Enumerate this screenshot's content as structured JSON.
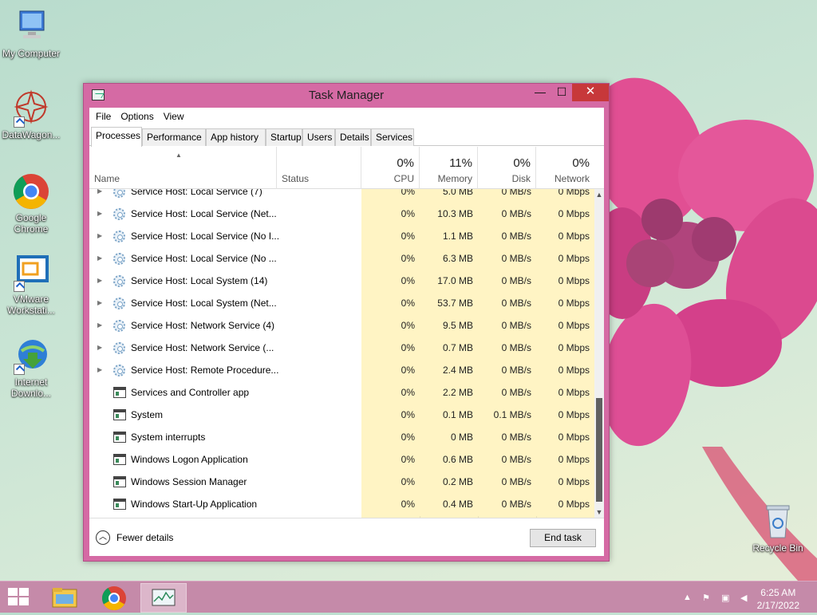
{
  "desktop": {
    "icons": [
      {
        "label": "My Computer",
        "icon": "computer-icon"
      },
      {
        "label": "DataWagon...",
        "icon": "datawagon-icon"
      },
      {
        "label": "Google Chrome",
        "icon": "chrome-icon"
      },
      {
        "label": "VMware Workstati...",
        "icon": "vmware-icon"
      },
      {
        "label": "Internet Downlo...",
        "icon": "idm-icon"
      },
      {
        "label": "Recycle Bin",
        "icon": "recycle-bin-icon"
      }
    ]
  },
  "window": {
    "title": "Task Manager",
    "controls": {
      "minimize": "—",
      "maximize": "☐",
      "close": "✕"
    },
    "menu": [
      "File",
      "Options",
      "View"
    ],
    "tabs": [
      "Processes",
      "Performance",
      "App history",
      "Startup",
      "Users",
      "Details",
      "Services"
    ],
    "active_tab": "Processes",
    "columns": {
      "name": "Name",
      "status": "Status",
      "cpu": {
        "pct": "0%",
        "label": "CPU"
      },
      "memory": {
        "pct": "11%",
        "label": "Memory"
      },
      "disk": {
        "pct": "0%",
        "label": "Disk"
      },
      "network": {
        "pct": "0%",
        "label": "Network"
      }
    },
    "processes": [
      {
        "name": "Service Host: Local Service (7)",
        "cpu": "0%",
        "memory": "5.0 MB",
        "disk": "0 MB/s",
        "network": "0 Mbps",
        "expandable": true,
        "icon": "gear"
      },
      {
        "name": "Service Host: Local Service (Net...",
        "cpu": "0%",
        "memory": "10.3 MB",
        "disk": "0 MB/s",
        "network": "0 Mbps",
        "expandable": true,
        "icon": "gear"
      },
      {
        "name": "Service Host: Local Service (No I...",
        "cpu": "0%",
        "memory": "1.1 MB",
        "disk": "0 MB/s",
        "network": "0 Mbps",
        "expandable": true,
        "icon": "gear"
      },
      {
        "name": "Service Host: Local Service (No ...",
        "cpu": "0%",
        "memory": "6.3 MB",
        "disk": "0 MB/s",
        "network": "0 Mbps",
        "expandable": true,
        "icon": "gear"
      },
      {
        "name": "Service Host: Local System (14)",
        "cpu": "0%",
        "memory": "17.0 MB",
        "disk": "0 MB/s",
        "network": "0 Mbps",
        "expandable": true,
        "icon": "gear"
      },
      {
        "name": "Service Host: Local System (Net...",
        "cpu": "0%",
        "memory": "53.7 MB",
        "disk": "0 MB/s",
        "network": "0 Mbps",
        "expandable": true,
        "icon": "gear"
      },
      {
        "name": "Service Host: Network Service (4)",
        "cpu": "0%",
        "memory": "9.5 MB",
        "disk": "0 MB/s",
        "network": "0 Mbps",
        "expandable": true,
        "icon": "gear"
      },
      {
        "name": "Service Host: Network Service (...",
        "cpu": "0%",
        "memory": "0.7 MB",
        "disk": "0 MB/s",
        "network": "0 Mbps",
        "expandable": true,
        "icon": "gear"
      },
      {
        "name": "Service Host: Remote Procedure...",
        "cpu": "0%",
        "memory": "2.4 MB",
        "disk": "0 MB/s",
        "network": "0 Mbps",
        "expandable": true,
        "icon": "gear"
      },
      {
        "name": "Services and Controller app",
        "cpu": "0%",
        "memory": "2.2 MB",
        "disk": "0 MB/s",
        "network": "0 Mbps",
        "expandable": false,
        "icon": "win"
      },
      {
        "name": "System",
        "cpu": "0%",
        "memory": "0.1 MB",
        "disk": "0.1 MB/s",
        "network": "0 Mbps",
        "expandable": false,
        "icon": "win"
      },
      {
        "name": "System interrupts",
        "cpu": "0%",
        "memory": "0 MB",
        "disk": "0 MB/s",
        "network": "0 Mbps",
        "expandable": false,
        "icon": "win"
      },
      {
        "name": "Windows Logon Application",
        "cpu": "0%",
        "memory": "0.6 MB",
        "disk": "0 MB/s",
        "network": "0 Mbps",
        "expandable": false,
        "icon": "win"
      },
      {
        "name": "Windows Session Manager",
        "cpu": "0%",
        "memory": "0.2 MB",
        "disk": "0 MB/s",
        "network": "0 Mbps",
        "expandable": false,
        "icon": "win"
      },
      {
        "name": "Windows Start-Up Application",
        "cpu": "0%",
        "memory": "0.4 MB",
        "disk": "0 MB/s",
        "network": "0 Mbps",
        "expandable": false,
        "icon": "win"
      }
    ],
    "footer": {
      "fewer_details": "Fewer details",
      "end_task": "End task"
    }
  },
  "taskbar": {
    "pinned": [
      "file-explorer-icon",
      "chrome-icon",
      "task-manager-icon"
    ],
    "time": "6:25 AM",
    "date": "2/17/2022"
  }
}
